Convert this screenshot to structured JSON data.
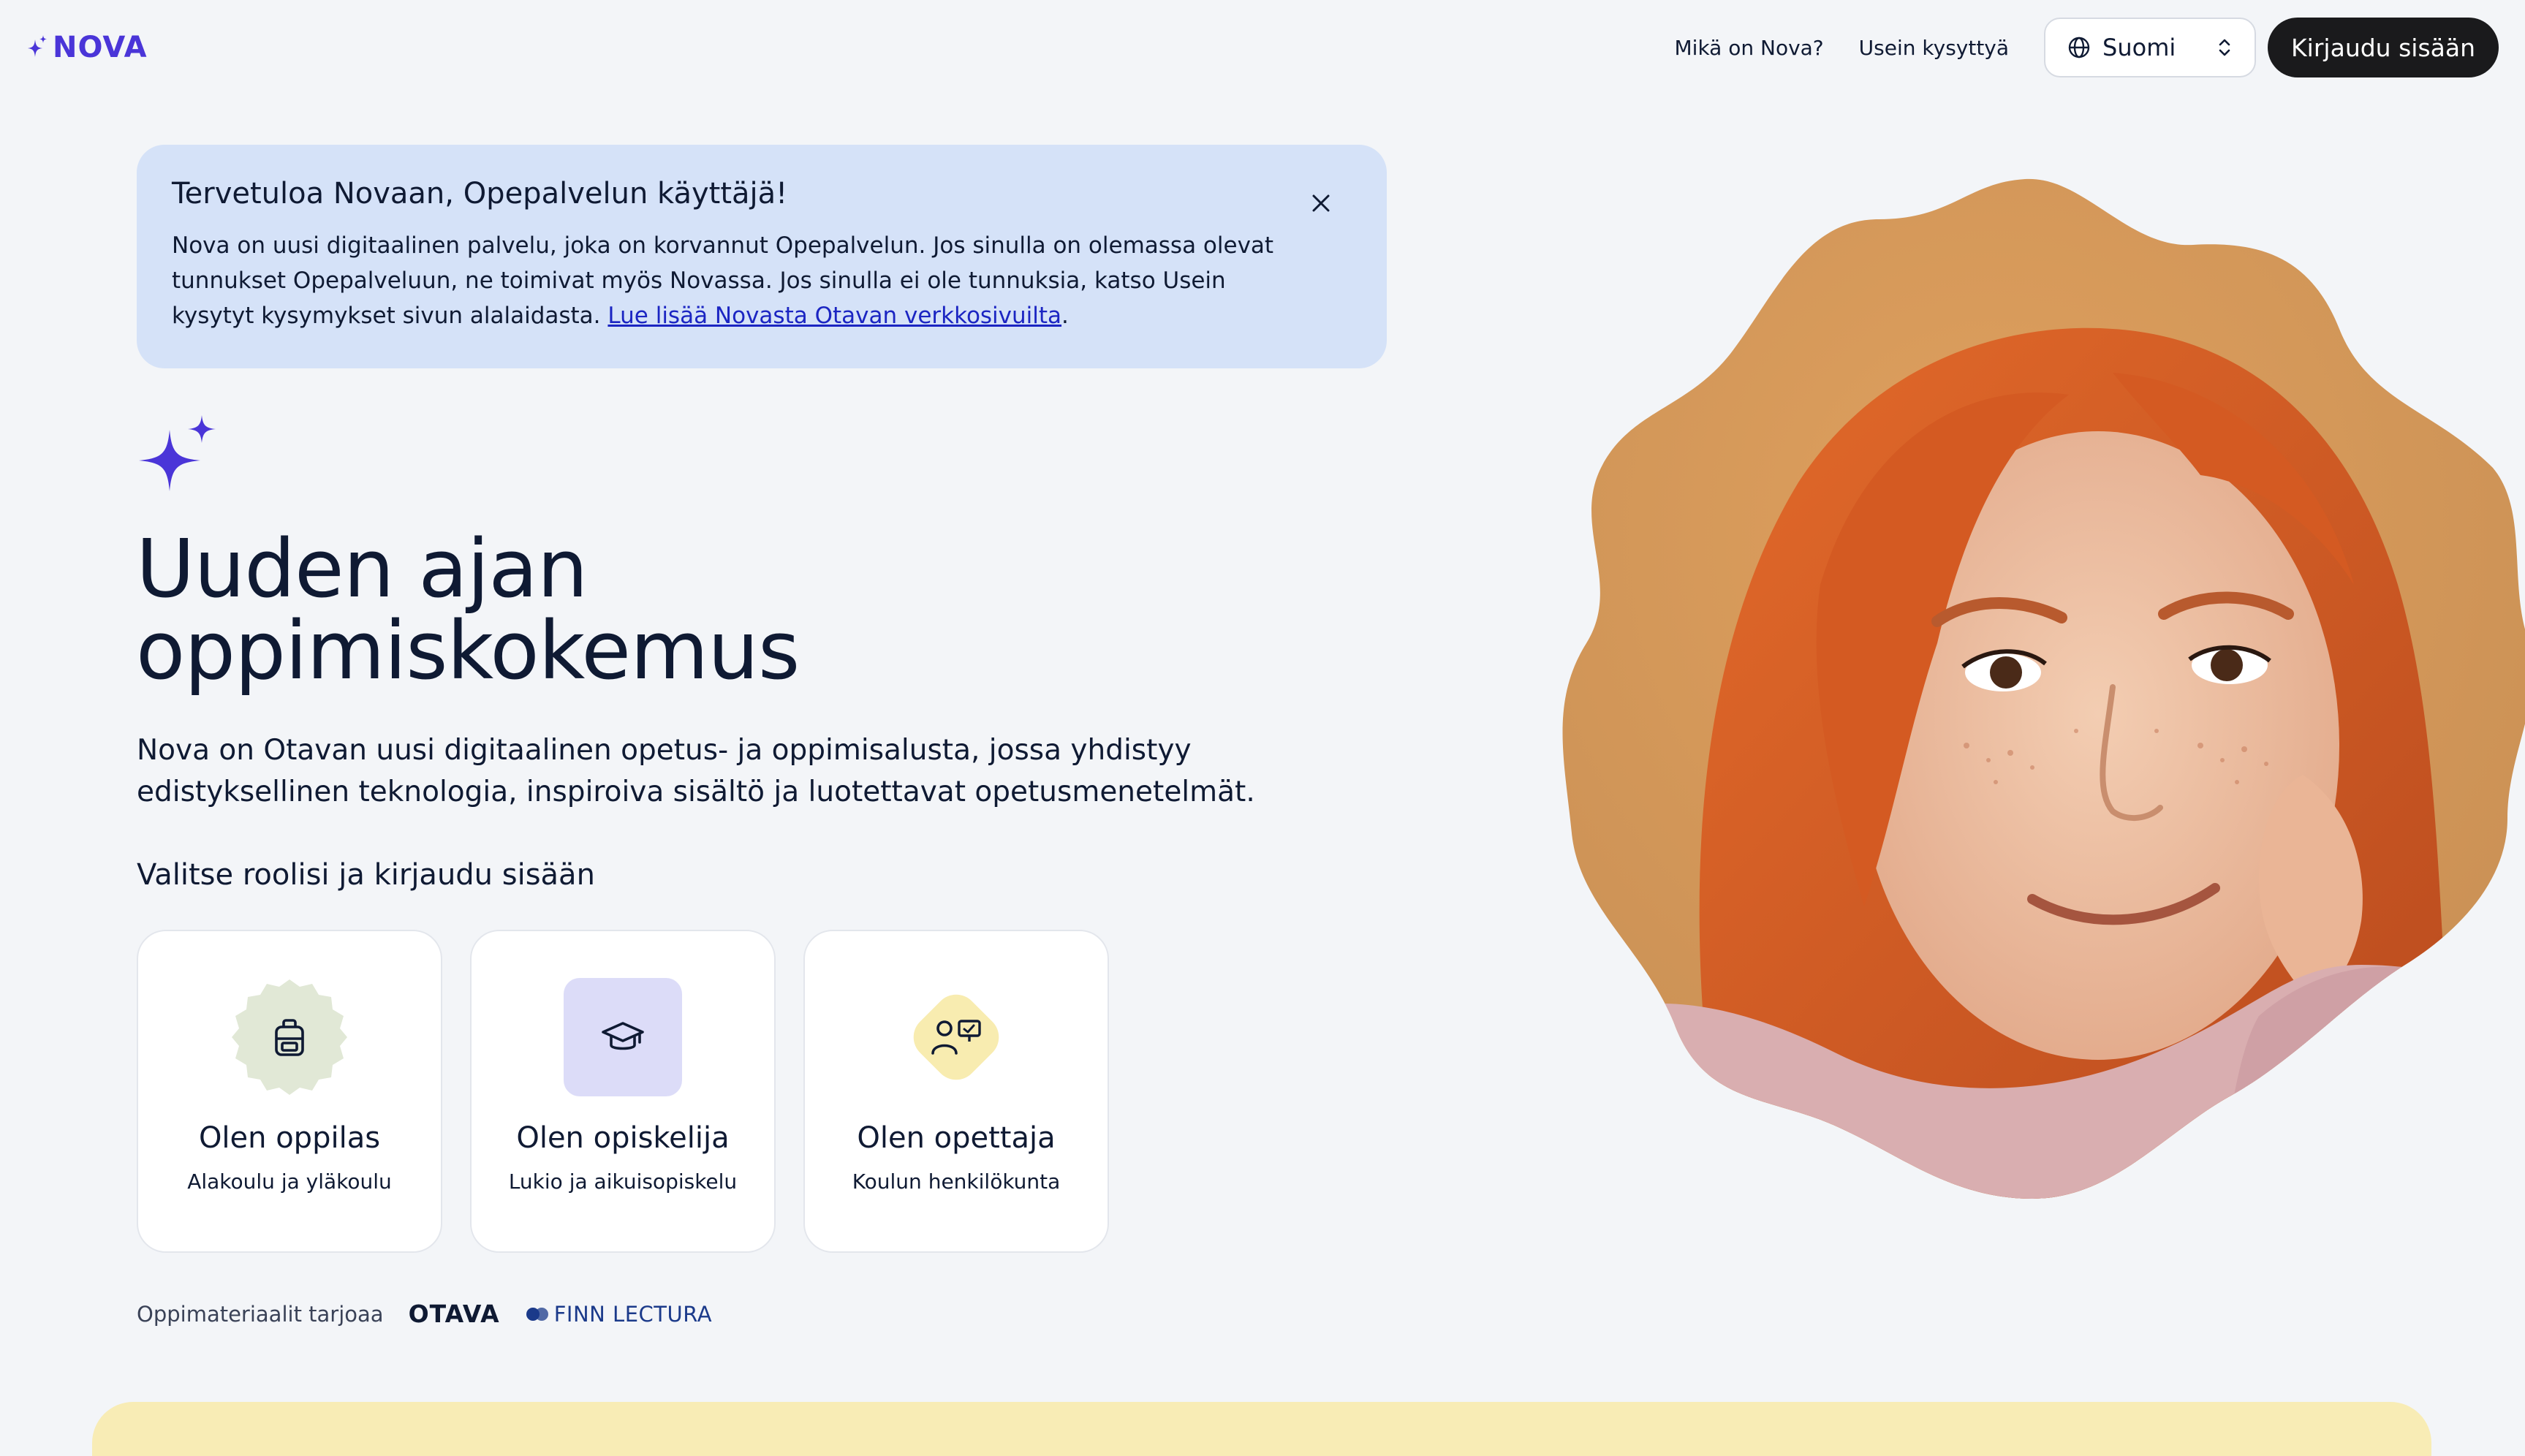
{
  "header": {
    "logo_text": "NOVA",
    "nav_links": [
      "Mikä on Nova?",
      "Usein kysyttyä"
    ],
    "language": "Suomi",
    "login_label": "Kirjaudu sisään"
  },
  "banner": {
    "title": "Tervetuloa Novaan, Opepalvelun käyttäjä!",
    "text": "Nova on uusi digitaalinen palvelu, joka on korvannut Opepalvelun. Jos sinulla on olemassa olevat tunnukset Opepalveluun, ne toimivat myös Novassa. Jos sinulla ei ole tunnuksia, katso Usein kysytyt kysymykset sivun alalaidasta.",
    "link_text": "Lue lisää Novasta Otavan verkkosivuilta",
    "after_link": "."
  },
  "hero": {
    "title_line1": "Uuden ajan",
    "title_line2": "oppimiskokemus",
    "description": "Nova on Otavan uusi digitaalinen opetus- ja oppimisalusta, jossa yhdistyy edistyksellinen teknologia, inspiroiva sisältö ja luotettavat opetusmenetelmät.",
    "role_heading": "Valitse roolisi ja kirjaudu sisään"
  },
  "roles": [
    {
      "title": "Olen oppilas",
      "subtitle": "Alakoulu ja yläkoulu",
      "icon": "backpack-icon",
      "color": "#e1e8d6"
    },
    {
      "title": "Olen opiskelija",
      "subtitle": "Lukio ja aikuisopiskelu",
      "icon": "graduation-cap-icon",
      "color": "#dcdcf8"
    },
    {
      "title": "Olen opettaja",
      "subtitle": "Koulun henkilökunta",
      "icon": "teacher-board-icon",
      "color": "#f8ecb0"
    }
  ],
  "providers": {
    "label": "Oppimateriaalit tarjoaa",
    "otava": "OTAVA",
    "finn_lectura": "FINN LECTURA"
  },
  "colors": {
    "brand": "#4a35d8",
    "background": "#f3f5f8",
    "banner_bg": "#d5e2f8",
    "link": "#1b25c2",
    "bottom_band": "#f8ecb5"
  }
}
